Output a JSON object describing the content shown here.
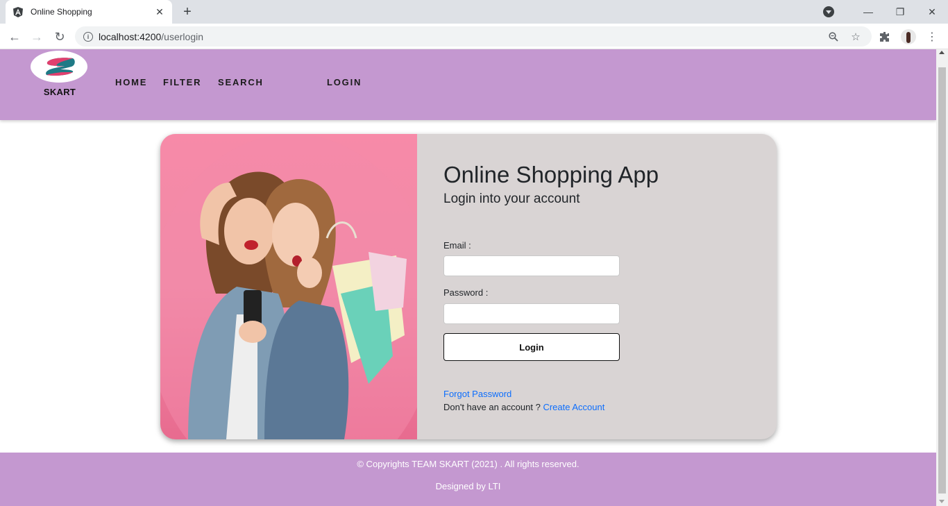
{
  "browser": {
    "tab_title": "Online Shopping",
    "url_host": "localhost:4200",
    "url_path": "/userlogin"
  },
  "header": {
    "brand": "SKART",
    "nav": {
      "home": "HOME",
      "filter": "FILTER",
      "search": "SEARCH",
      "login": "LOGIN"
    }
  },
  "login": {
    "title": "Online Shopping App",
    "subtitle": "Login into your account",
    "email_label": "Email :",
    "email_value": "",
    "password_label": "Password :",
    "password_value": "",
    "button": "Login",
    "forgot": "Forgot Password",
    "no_account": "Don't have an account ?",
    "create": "Create Account"
  },
  "footer": {
    "copyright": "© Copyrights TEAM SKART (2021) . All rights reserved.",
    "designed": "Designed by LTI"
  },
  "colors": {
    "header_bg": "#c498d0",
    "card_bg": "#d9d4d4",
    "photo_bg": "#f78aa8",
    "link": "#0d6efd"
  }
}
